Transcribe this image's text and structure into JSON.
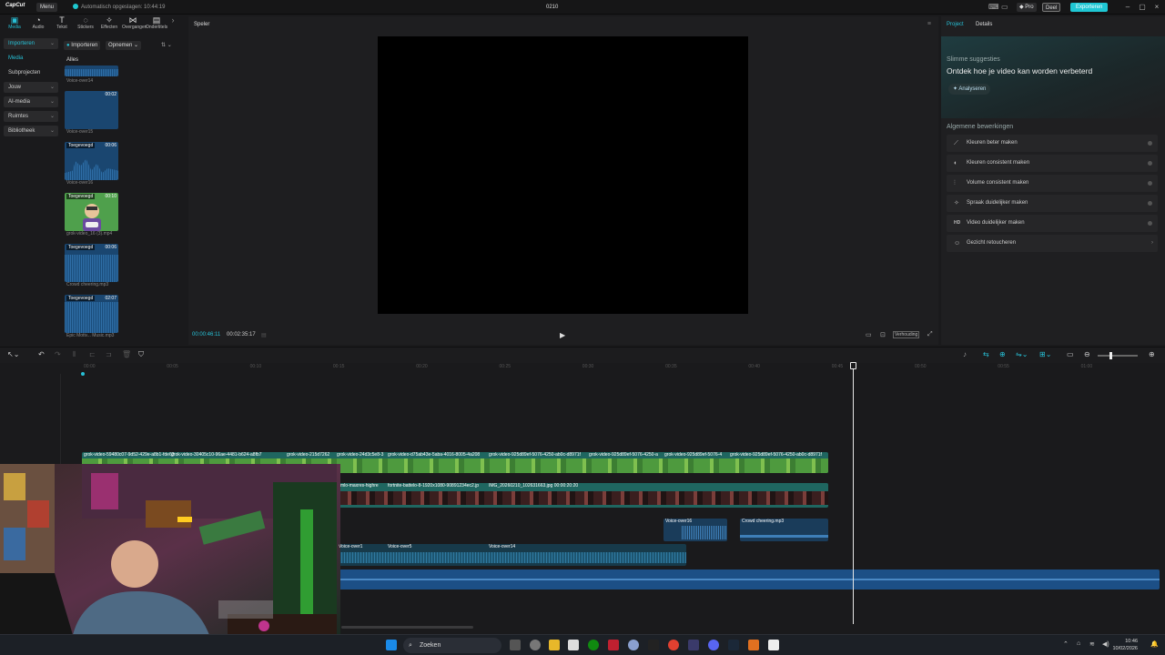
{
  "titlebar": {
    "logo": "CapCut",
    "menu_label": "Menu",
    "autosave": "Automatisch opgeslagen: 10:44:19",
    "project_title": "0210",
    "pro_label": "Pro",
    "share_label": "Deel",
    "export_label": "Exporteren"
  },
  "toolbar": {
    "items": [
      {
        "label": "Media",
        "icon": "media-icon"
      },
      {
        "label": "Audio",
        "icon": "audio-icon"
      },
      {
        "label": "Tekst",
        "icon": "text-icon"
      },
      {
        "label": "Stickers",
        "icon": "sticker-icon"
      },
      {
        "label": "Effecten",
        "icon": "effects-icon"
      },
      {
        "label": "Overgangen",
        "icon": "transition-icon"
      },
      {
        "label": "Ondertitels",
        "icon": "subtitle-icon"
      }
    ]
  },
  "sidenav": {
    "items": [
      "Importeren",
      "Media",
      "Subprojecten",
      "Jouw",
      "AI-media",
      "Ruimtes",
      "Bibliotheek"
    ]
  },
  "media": {
    "import_label": "Importeren",
    "store_label": "Opnemen",
    "filter_label": "Alles",
    "items": [
      {
        "caption": "Voice-over14",
        "badge": "",
        "duration": ""
      },
      {
        "caption": "Voice-over15",
        "badge": "",
        "duration": "00:02"
      },
      {
        "caption": "Voice-over16",
        "badge": "Toegevoegd",
        "duration": "00:06"
      },
      {
        "caption": "grok-video_16 (3).mp4",
        "badge": "Toegevoegd",
        "duration": "00:10"
      },
      {
        "caption": "Crowd cheering.mp3",
        "badge": "Toegevoegd",
        "duration": "00:06"
      },
      {
        "caption": "Epic Motiv... Music.mp3",
        "badge": "Toegevoegd",
        "duration": "02:07"
      }
    ]
  },
  "player": {
    "header": "Speler",
    "current_time": "00:00:46:11",
    "total_time": "00:02:35:17",
    "ratio_label": "Verhouding"
  },
  "rightpanel": {
    "tabs": [
      "Project",
      "Details"
    ],
    "suggest_title": "Slimme suggesties",
    "suggest_heading": "Ontdek hoe je video kan worden verbeterd",
    "analyze_label": "Analyseren",
    "general_title": "Algemene bewerkingen",
    "rows": [
      {
        "label": "Kleuren beter maken",
        "icon": "magic-wand-icon"
      },
      {
        "label": "Kleuren consistent maken",
        "icon": "palette-icon"
      },
      {
        "label": "Volume consistent maken",
        "icon": "equalizer-icon"
      },
      {
        "label": "Spraak duidelijker maken",
        "icon": "sparkle-icon"
      },
      {
        "label": "Video duidelijker maken",
        "icon": "hd-icon"
      },
      {
        "label": "Gezicht retoucheren",
        "icon": "face-icon"
      }
    ]
  },
  "ruler": {
    "ticks": [
      "00:00",
      "00:05",
      "00:10",
      "00:15",
      "00:20",
      "00:25",
      "00:30",
      "00:35",
      "00:40",
      "00:45",
      "00:50",
      "00:55",
      "01:00"
    ]
  },
  "tracks": {
    "video1_labels": [
      "grok-video-59480c07-9d52-429e-a8b1-fde62",
      "grok-video-30405c10-96ae-4481-b624-a8fb7",
      "grok-video-215d7262",
      "grok-video-24d3c5e8-3",
      "grok-video-d75ab43e-5aba-4016-8005-4a208",
      "grok-video-925d89ef-5076-4250-ab0c-d8971f",
      "grok-video-925d89ef-5076-4250-a",
      "grok-video-925d89ef-5076-4",
      "grok-video-925d89ef-5076-4250-ab0c-d8971f"
    ],
    "video2_labels": [
      "mlo-maxres-highre",
      "fortnite-battelo-8-1920x1080-90891234ec2.jp",
      "IMG_20260210_102631663.jpg  00:00:20:20"
    ],
    "audio1_labels": [
      "Voice-over16",
      "Crowd cheering.mp3"
    ],
    "audio2_labels": [
      "Voice-over1",
      "Voice-over5",
      "Voice-over14"
    ]
  },
  "taskbar": {
    "search_label": "Zoeken",
    "time": "10:46",
    "date": "10/02/2026"
  }
}
